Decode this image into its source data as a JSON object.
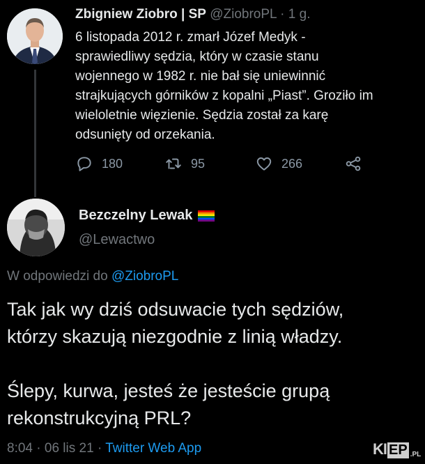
{
  "tweet1": {
    "author_name": "Zbigniew Ziobro | SP",
    "handle": "@ZiobroPL",
    "separator": "·",
    "time_ago": "1 g.",
    "text_lines": [
      "6 listopada 2012 r. zmarł Józef Medyk -",
      "sprawiedliwy sędzia, który w czasie stanu",
      "wojennego w 1982 r. nie bał się uniewinnić",
      "strajkujących górników z kopalni „Piast”. Groziło im",
      "wieloletnie więzienie. Sędzia został za karę",
      "odsunięty od orzekania."
    ],
    "replies": "180",
    "retweets": "95",
    "likes": "266"
  },
  "tweet2": {
    "author_name": "Bezczelny Lewak",
    "handle": "@Lewactwo",
    "reply_prefix": "W odpowiedzi do",
    "reply_to": "@ZiobroPL",
    "text_lines": [
      "Tak jak wy dziś odsuwacie tych sędziów,",
      "którzy skazują niezgodnie z linią władzy.",
      "",
      "Ślepy, kurwa, jesteś że jesteście grupą",
      "rekonstrukcyjną PRL?"
    ],
    "time": "8:04",
    "date": "06 lis 21",
    "separator": "·",
    "source": "Twitter Web App"
  },
  "watermark": {
    "part1": "KI",
    "part2": "EP",
    "part3": ".PL"
  },
  "colors": {
    "background": "#000000",
    "text": "#e7e9ea",
    "muted": "#71767b",
    "link": "#1d9bf0",
    "thread_line": "#333639"
  },
  "icons": [
    "reply-icon",
    "retweet-icon",
    "like-icon",
    "share-icon",
    "rainbow-flag-icon"
  ]
}
